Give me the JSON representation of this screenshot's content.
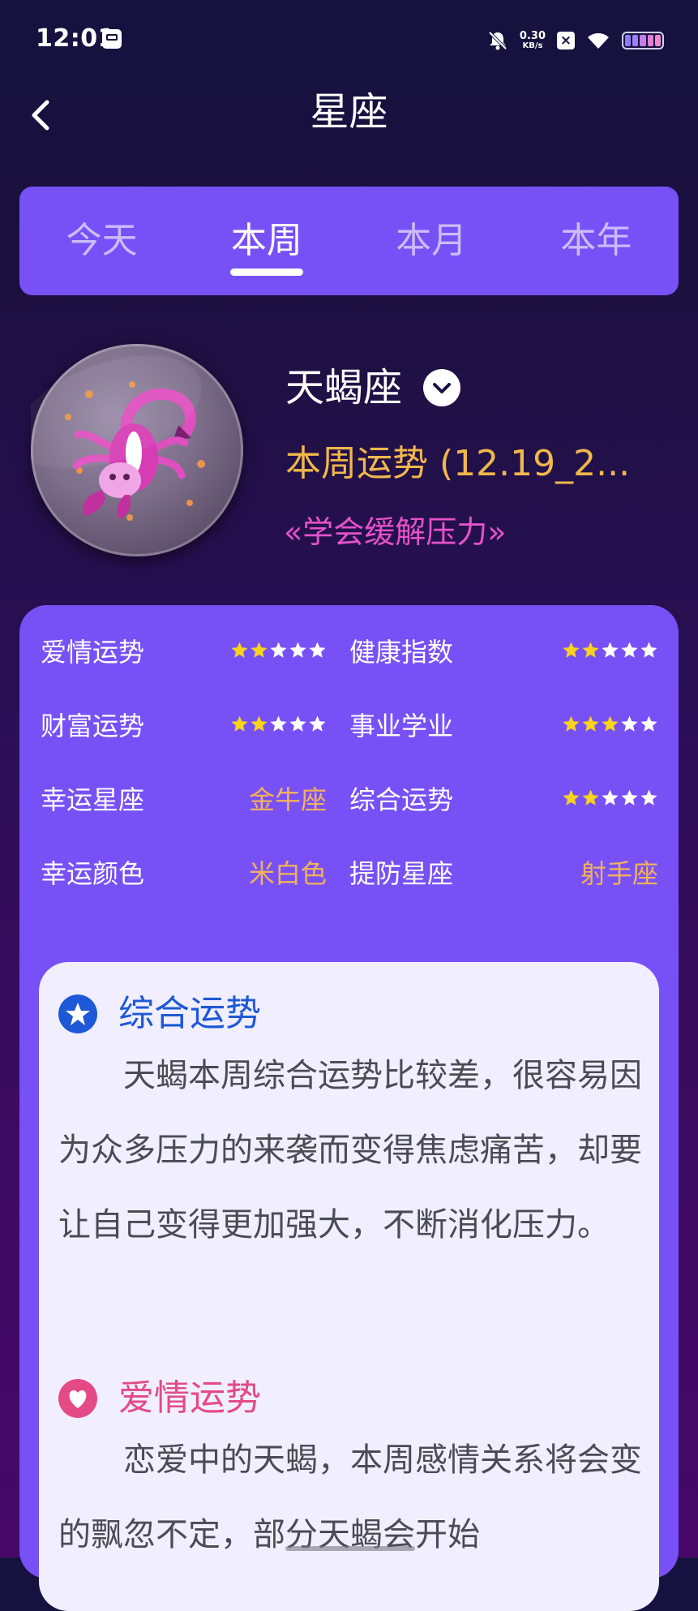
{
  "status_bar": {
    "time": "12:01",
    "net_speed_value": "0.30",
    "net_speed_unit": "KB/s",
    "icons": [
      "sim-icon",
      "mute-icon",
      "close-box-icon",
      "wifi-icon",
      "battery-icon"
    ]
  },
  "header": {
    "title": "星座",
    "back_icon": "chevron-left-icon"
  },
  "tabs": [
    {
      "label": "今天",
      "active": false
    },
    {
      "label": "本周",
      "active": true
    },
    {
      "label": "本月",
      "active": false
    },
    {
      "label": "本年",
      "active": false
    }
  ],
  "sign": {
    "name": "天蝎座",
    "dropdown_icon": "chevron-down-icon",
    "period": "本周运势 (12.19_2...",
    "motto": "«学会缓解压力»"
  },
  "fortune": {
    "love": {
      "label": "爱情运势",
      "stars": 2,
      "max": 5
    },
    "health": {
      "label": "健康指数",
      "stars": 2,
      "max": 5
    },
    "wealth": {
      "label": "财富运势",
      "stars": 2,
      "max": 5
    },
    "career": {
      "label": "事业学业",
      "stars": 3,
      "max": 5
    },
    "lucky_sign": {
      "label": "幸运星座",
      "value": "金牛座"
    },
    "overall": {
      "label": "综合运势",
      "stars": 2,
      "max": 5
    },
    "lucky_color": {
      "label": "幸运颜色",
      "value": "米白色"
    },
    "beware_sign": {
      "label": "提防星座",
      "value": "射手座"
    }
  },
  "details": {
    "overall": {
      "title": "综合运势",
      "text": "天蝎本周综合运势比较差，很容易因为众多压力的来袭而变得焦虑痛苦，却要让自己变得更加强大，不断消化压力。"
    },
    "love": {
      "title": "爱情运势",
      "text": "恋爱中的天蝎，本周感情关系将会变的飘忽不定，部分天蝎会开始"
    }
  },
  "colors": {
    "accent_purple": "#7751f6",
    "star_gold": "#f8d21c",
    "star_empty": "#ffffff",
    "value_orange": "#f4b15b",
    "period_gold": "#f0b84a",
    "motto_pink": "#e552c9",
    "overall_blue": "#1f58d6",
    "love_pink": "#e44a86"
  }
}
